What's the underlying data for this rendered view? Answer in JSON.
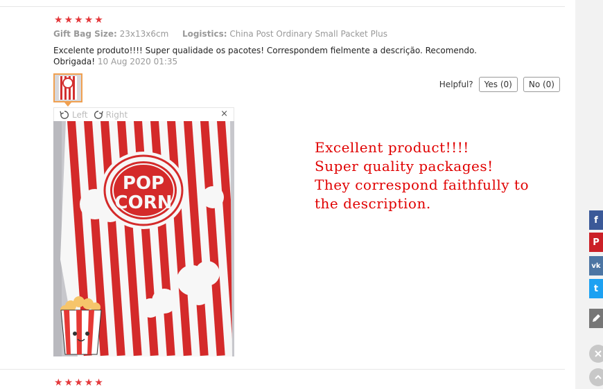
{
  "review": {
    "rating_icon": "five-star-rating",
    "gift_bag_label": "Gift Bag Size:",
    "gift_bag_value": "23x13x6cm",
    "logistics_label": "Logistics:",
    "logistics_value": "China Post Ordinary Small Packet Plus",
    "text": "Excelente produto!!!! Super qualidade os pacotes! Correspondem fielmente a descrição. Recomendo. Obrigada!",
    "date": "10 Aug 2020 01:35"
  },
  "helpful": {
    "label": "Helpful?",
    "yes": "Yes (0)",
    "no": "No (0)"
  },
  "viewer": {
    "rotate_left": "Left",
    "rotate_right": "Right",
    "close": "×",
    "photo_text_1": "POP",
    "photo_text_2": "CORN"
  },
  "translation": {
    "line1": "Excellent product!!!!",
    "line2": "Super quality packages!",
    "line3": "They correspond faithfully to",
    "line4": "the description."
  },
  "share": {
    "facebook": "f",
    "pinterest": "P",
    "vk": "vk",
    "twitter": "t"
  },
  "colors": {
    "star": "#e4393c",
    "translation_text": "#e00000",
    "thumb_border": "#f0a050",
    "facebook": "#3b5998",
    "pinterest": "#cb2027",
    "vk": "#4c75a3",
    "twitter": "#1da1f2",
    "edit": "#777777"
  }
}
